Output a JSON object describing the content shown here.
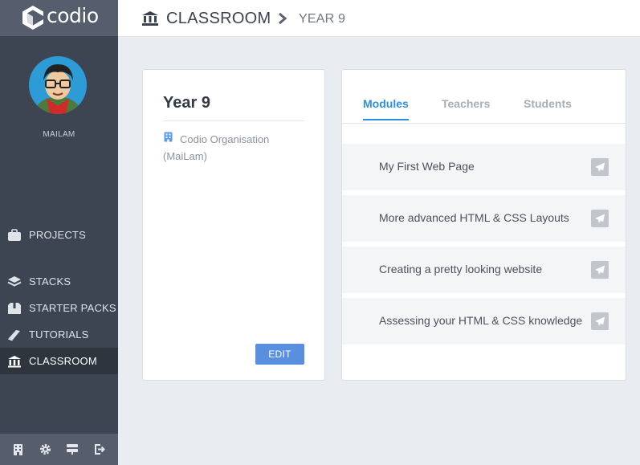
{
  "app": {
    "logo_text": "codio"
  },
  "user": {
    "name": "MAILAM"
  },
  "sidebar": {
    "items": [
      {
        "label": "PROJECTS",
        "icon": "briefcase-icon"
      },
      {
        "label": "STACKS",
        "icon": "layers-icon"
      },
      {
        "label": "STARTER PACKS",
        "icon": "box-icon"
      },
      {
        "label": "TUTORIALS",
        "icon": "book-icon"
      },
      {
        "label": "CLASSROOM",
        "icon": "classroom-icon",
        "active": true
      }
    ],
    "bottom_icons": [
      "organisation-icon",
      "gear-icon",
      "server-icon",
      "logout-icon"
    ]
  },
  "header": {
    "breadcrumb": [
      "CLASSROOM",
      "YEAR 9"
    ]
  },
  "class_card": {
    "title": "Year 9",
    "organisation": "Codio Organisation (MaiLam)",
    "edit_label": "EDIT"
  },
  "tabs": [
    {
      "label": "Modules",
      "active": true
    },
    {
      "label": "Teachers",
      "active": false
    },
    {
      "label": "Students",
      "active": false
    }
  ],
  "modules": [
    {
      "title": "My First Web Page"
    },
    {
      "title": "More advanced HTML & CSS Layouts"
    },
    {
      "title": "Creating a pretty looking website"
    },
    {
      "title": "Assessing your HTML & CSS knowledge"
    }
  ],
  "colors": {
    "sidebar": "#3e4552",
    "accent": "#2d8fdd",
    "edit_button": "#5a8fe0"
  }
}
